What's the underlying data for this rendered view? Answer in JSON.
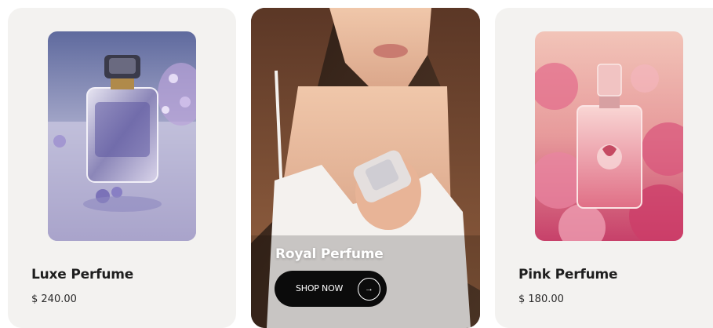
{
  "products": [
    {
      "name": "Luxe Perfume",
      "price": "$ 240.00"
    },
    {
      "name": "Royal Perfume",
      "cta": "SHOP NOW",
      "cta_icon": "→"
    },
    {
      "name": "Pink Perfume",
      "price": "$ 180.00"
    }
  ],
  "colors": {
    "card_bg": "#f3f2f0",
    "button_bg": "#0b0b0b",
    "title_text": "#1e1e1e"
  }
}
